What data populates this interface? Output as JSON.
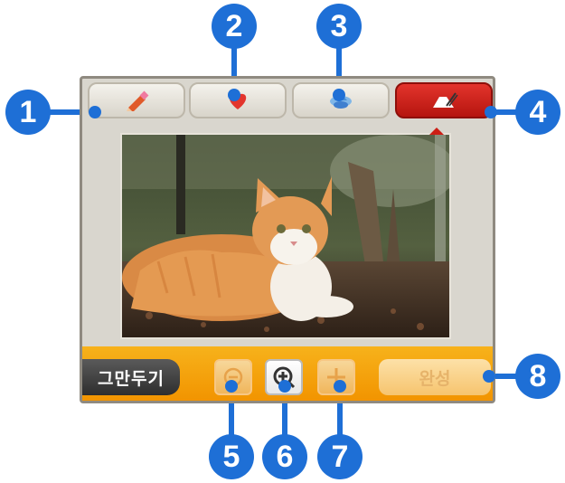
{
  "toolbar": {
    "tools": [
      {
        "icon": "pencil-icon",
        "active": false
      },
      {
        "icon": "stamp-heart-icon",
        "active": false
      },
      {
        "icon": "background-frame-icon",
        "active": false
      },
      {
        "icon": "photo-edit-icon",
        "active": true
      }
    ]
  },
  "bottombar": {
    "quit_label": "그만두기",
    "zoom_out_icon": "zoom-out-icon",
    "zoom_in_icon": "zoom-in-icon",
    "move_icon": "move-icon",
    "done_label": "완성"
  },
  "callouts": [
    "1",
    "2",
    "3",
    "4",
    "5",
    "6",
    "7",
    "8"
  ],
  "colors": {
    "callout": "#1e6fd6",
    "bar": "#f29400",
    "active_tab": "#cc1e15",
    "quit_button": "#3a3a3a"
  }
}
